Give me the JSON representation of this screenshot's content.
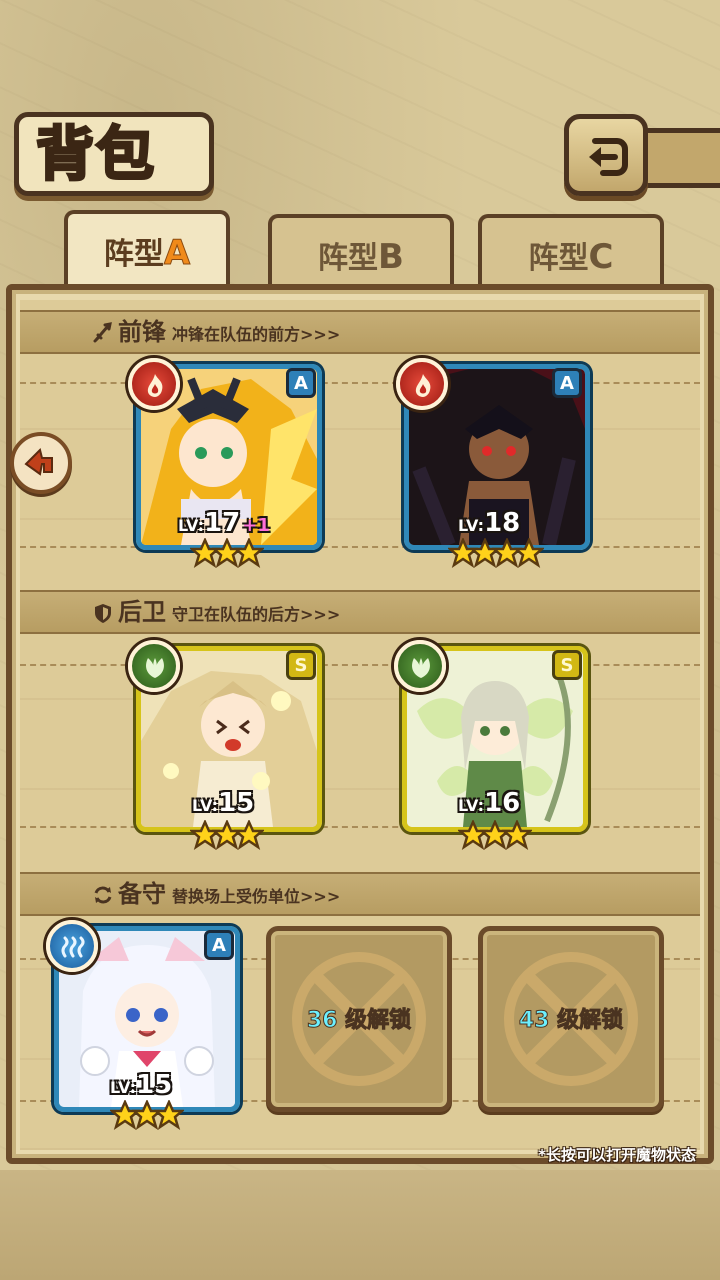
{
  "header": {
    "title": "背包",
    "back_icon": "return-arrow-icon"
  },
  "tabs": [
    {
      "label": "阵型",
      "letter": "A",
      "active": true
    },
    {
      "label": "阵型",
      "letter": "B",
      "active": false
    },
    {
      "label": "阵型",
      "letter": "C",
      "active": false
    }
  ],
  "sections": {
    "front": {
      "title": "前锋",
      "desc": "冲锋在队伍的前方>>>"
    },
    "back": {
      "title": "后卫",
      "desc": "守卫在队伍的后方>>>"
    },
    "reserve": {
      "title": "备守",
      "desc": "替换场上受伤单位>>>"
    }
  },
  "units": [
    {
      "element": "fire",
      "rank": "A",
      "lv_label": "LV:",
      "level": "17",
      "bonus": "+1",
      "stars": 3
    },
    {
      "element": "fire",
      "rank": "A",
      "lv_label": "LV:",
      "level": "18",
      "stars": 4
    },
    {
      "element": "leaf",
      "rank": "S",
      "lv_label": "LV:",
      "level": "15",
      "stars": 3
    },
    {
      "element": "leaf",
      "rank": "S",
      "lv_label": "LV:",
      "level": "16",
      "stars": 3
    },
    {
      "element": "water",
      "rank": "A",
      "lv_label": "LV:",
      "level": "15",
      "stars": 3
    }
  ],
  "locked_slots": [
    {
      "level": "36",
      "text": "级解锁"
    },
    {
      "level": "43",
      "text": "级解锁"
    }
  ],
  "hint": "*长按可以打开魔物状态",
  "colors": {
    "fire": "#c0281e",
    "leaf": "#3c7a2a",
    "water": "#2a7ac0",
    "rank_a": "#2e80b8",
    "rank_s": "#d2b814"
  }
}
